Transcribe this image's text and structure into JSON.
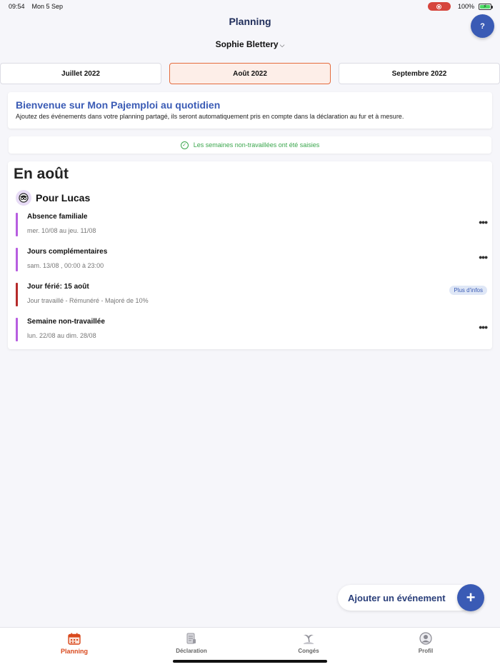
{
  "status_bar": {
    "time": "09:54",
    "date": "Mon 5 Sep",
    "battery": "100%"
  },
  "header": {
    "title": "Planning",
    "help_label": "?"
  },
  "person_select": {
    "name": "Sophie Blettery",
    "chevron": "⌵"
  },
  "months": [
    {
      "label": "Juillet 2022",
      "active": false
    },
    {
      "label": "Août 2022",
      "active": true
    },
    {
      "label": "Septembre 2022",
      "active": false
    }
  ],
  "welcome": {
    "title": "Bienvenue sur Mon Pajemploi au quotidien",
    "text": "Ajoutez des événements dans votre planning partagé, ils seront automatiquement pris en compte dans la déclaration au fur et à mesure."
  },
  "info_banner": {
    "text": "Les semaines non-travaillées ont été saisies"
  },
  "events_section": {
    "heading": "En août",
    "child": "Pour Lucas",
    "events": [
      {
        "title": "Absence familiale",
        "subtitle": "mer. 10/08 au jeu. 11/08",
        "color": "#b75de0",
        "action": "more"
      },
      {
        "title": "Jours complémentaires",
        "subtitle": "sam. 13/08 , 00:00 à 23:00",
        "color": "#b75de0",
        "action": "more"
      },
      {
        "title": "Jour férié: 15 août",
        "subtitle": "Jour travaillé - Rémunéré - Majoré de 10%",
        "color": "#b52a2a",
        "action": "badge",
        "badge": "Plus d'infos"
      },
      {
        "title": "Semaine non-travaillée",
        "subtitle": "lun. 22/08 au dim. 28/08",
        "color": "#b75de0",
        "action": "more"
      }
    ]
  },
  "add_event": {
    "label": "Ajouter un événement",
    "plus": "+"
  },
  "tabbar": [
    {
      "label": "Planning",
      "icon": "calendar-icon",
      "active": true
    },
    {
      "label": "Déclaration",
      "icon": "document-icon",
      "active": false
    },
    {
      "label": "Congés",
      "icon": "beach-icon",
      "active": false
    },
    {
      "label": "Profil",
      "icon": "user-icon",
      "active": false
    }
  ],
  "colors": {
    "accent": "#3a5bb5",
    "active_tab": "#d9491d",
    "success": "#3aa64c"
  }
}
